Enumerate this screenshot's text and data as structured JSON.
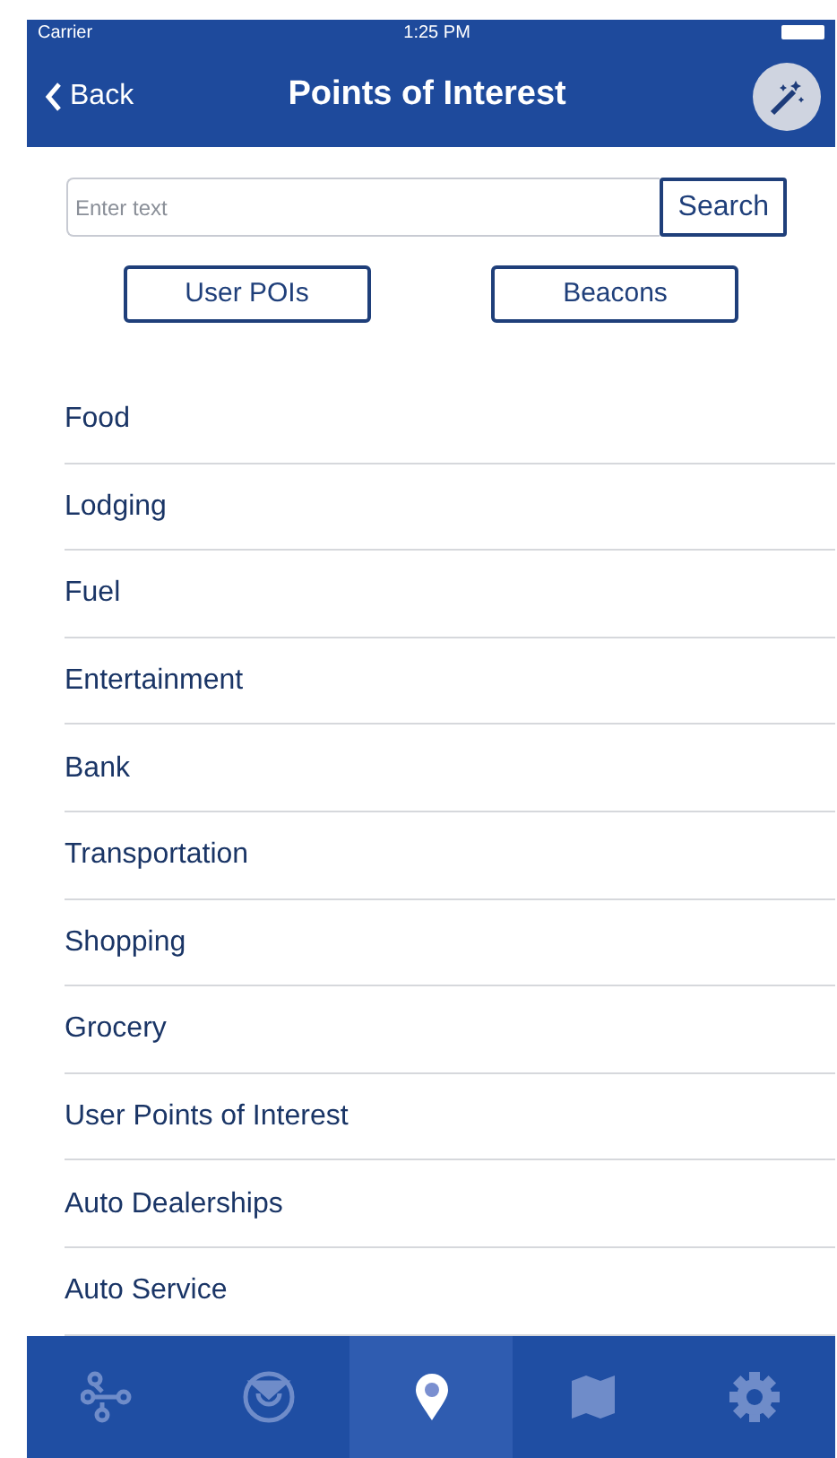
{
  "status_bar": {
    "carrier": "Carrier",
    "time": "1:25 PM"
  },
  "nav_bar": {
    "back": "Back",
    "title": "Points of Interest"
  },
  "search": {
    "placeholder": "Enter text",
    "button": "Search"
  },
  "filter_buttons": [
    "User POIs",
    "Beacons"
  ],
  "categories": [
    "Food",
    "Lodging",
    "Fuel",
    "Entertainment",
    "Bank",
    "Transportation",
    "Shopping",
    "Grocery",
    "User Points of Interest",
    "Auto Dealerships",
    "Auto Service"
  ],
  "tab_bar": [
    {
      "kind": "network",
      "selected": false
    },
    {
      "kind": "radar",
      "selected": false
    },
    {
      "kind": "pin",
      "selected": true
    },
    {
      "kind": "map",
      "selected": false
    },
    {
      "kind": "gear",
      "selected": false
    }
  ]
}
